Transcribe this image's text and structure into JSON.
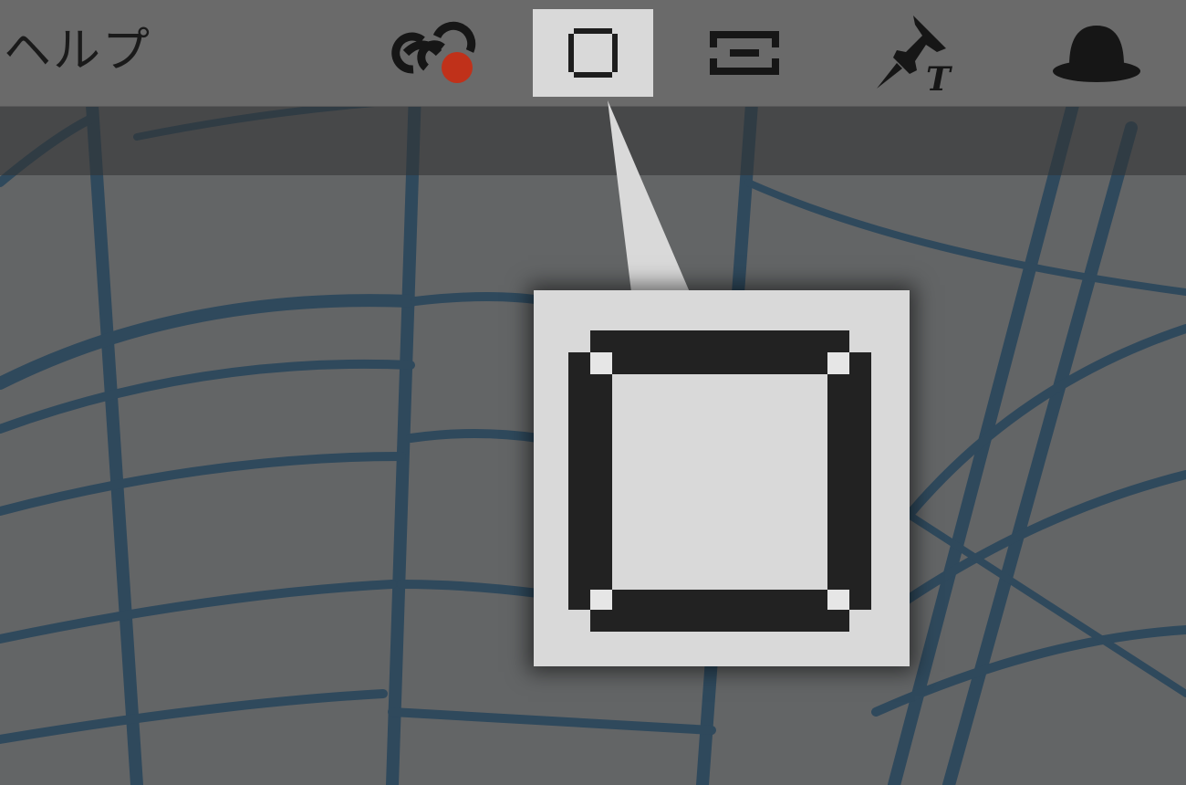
{
  "menubar": {
    "help_label": "ヘルプ"
  },
  "toolbar": {
    "items": [
      {
        "name": "creative-cloud-icon",
        "badge_color": "#c0311a"
      },
      {
        "name": "single-window-icon",
        "active": true
      },
      {
        "name": "split-view-icon"
      },
      {
        "name": "pin-text-icon"
      },
      {
        "name": "bowler-hat-icon"
      }
    ]
  },
  "callout": {
    "icon": "single-window-icon"
  },
  "colors": {
    "menubar": "#6a6a6a",
    "icon": "#1a1a1a",
    "active_background": "#d9d9d9",
    "steel_blue": "#1f4a6e"
  }
}
